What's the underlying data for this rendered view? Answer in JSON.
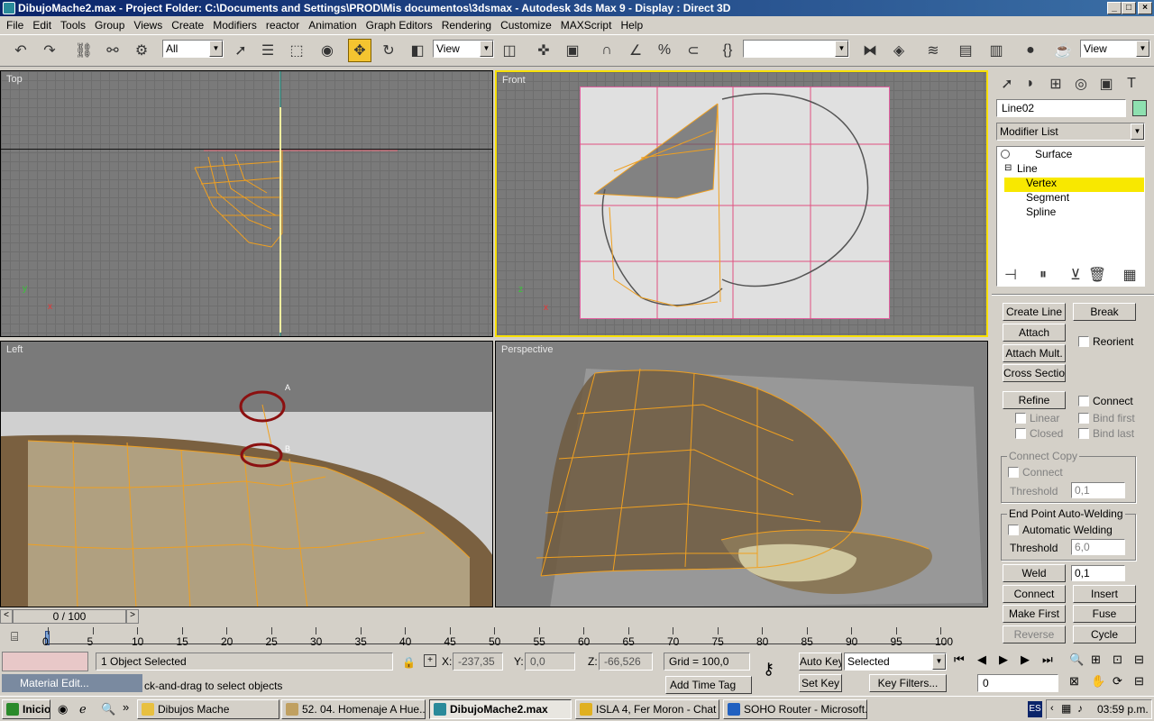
{
  "window": {
    "title": "DibujoMache2.max     - Project Folder: C:\\Documents and Settings\\PROD\\Mis documentos\\3dsmax     - Autodesk 3ds Max 9     - Display : Direct 3D",
    "minimize": "_",
    "maximize": "□",
    "close": "×"
  },
  "menu": [
    "File",
    "Edit",
    "Tools",
    "Group",
    "Views",
    "Create",
    "Modifiers",
    "reactor",
    "Animation",
    "Graph Editors",
    "Rendering",
    "Customize",
    "MAXScript",
    "Help"
  ],
  "toolbar": {
    "selection_filter": "All",
    "ref_coord": "View",
    "named_selection": "",
    "render_view": "View"
  },
  "viewports": {
    "top": "Top",
    "front": "Front",
    "left": "Left",
    "perspective": "Perspective",
    "annot_a": "A",
    "annot_b": "B"
  },
  "command_panel": {
    "object_name": "Line02",
    "object_color": "#8ee0b0",
    "modifier_list": "Modifier List",
    "stack": [
      {
        "label": "Surface",
        "level": 0,
        "selected": false
      },
      {
        "label": "Line",
        "level": 0,
        "selected": false
      },
      {
        "label": "Vertex",
        "level": 1,
        "selected": true
      },
      {
        "label": "Segment",
        "level": 1,
        "selected": false
      },
      {
        "label": "Spline",
        "level": 1,
        "selected": false
      }
    ],
    "buttons": {
      "create_line": "Create Line",
      "break": "Break",
      "attach": "Attach",
      "reorient": "Reorient",
      "attach_mult": "Attach Mult.",
      "cross_section": "Cross Section",
      "refine": "Refine",
      "connect": "Connect",
      "linear": "Linear",
      "bind_first": "Bind first",
      "closed": "Closed",
      "bind_last": "Bind last",
      "connect_copy": "Connect Copy",
      "connect2": "Connect",
      "threshold": "Threshold",
      "threshold_val": "0,1",
      "end_point": "End Point Auto-Welding",
      "auto_weld": "Automatic Welding",
      "threshold2": "Threshold",
      "threshold2_val": "6,0",
      "weld": "Weld",
      "weld_val": "0,1",
      "connect3": "Connect",
      "insert": "Insert",
      "make_first": "Make First",
      "fuse": "Fuse",
      "reverse": "Reverse",
      "cycle": "Cycle"
    }
  },
  "timeline": {
    "frame": "0 / 100",
    "ticks": [
      "0",
      "5",
      "10",
      "15",
      "20",
      "25",
      "30",
      "35",
      "40",
      "45",
      "50",
      "55",
      "60",
      "65",
      "70",
      "75",
      "80",
      "85",
      "90",
      "95",
      "100"
    ]
  },
  "status": {
    "selected": "1 Object Selected",
    "prompt": "ck-and-drag to select objects",
    "x_label": "X:",
    "x_val": "-237,35",
    "y_label": "Y:",
    "y_val": "0,0",
    "z_label": "Z:",
    "z_val": "-66,526",
    "grid": "Grid = 100,0",
    "add_time_tag": "Add Time Tag",
    "auto_key": "Auto Key",
    "set_key": "Set Key",
    "key_mode": "Selected",
    "key_filters": "Key Filters...",
    "frame_field": "0"
  },
  "material_editor": {
    "label": "Material Edit..."
  },
  "taskbar": {
    "start": "Inicio",
    "tasks": [
      {
        "label": "Dibujos Mache",
        "color": "#e8c040",
        "active": false
      },
      {
        "label": "52. 04. Homenaje A Hue...",
        "color": "#c0a060",
        "active": false
      },
      {
        "label": "DibujoMache2.max",
        "color": "#2a8a9a",
        "active": true
      },
      {
        "label": "ISLA 4, Fer Moron - Chat",
        "color": "#e0b020",
        "active": false
      },
      {
        "label": "SOHO Router - Microsoft...",
        "color": "#2060c0",
        "active": false
      }
    ],
    "lang": "ES",
    "clock": "03:59 p.m."
  }
}
